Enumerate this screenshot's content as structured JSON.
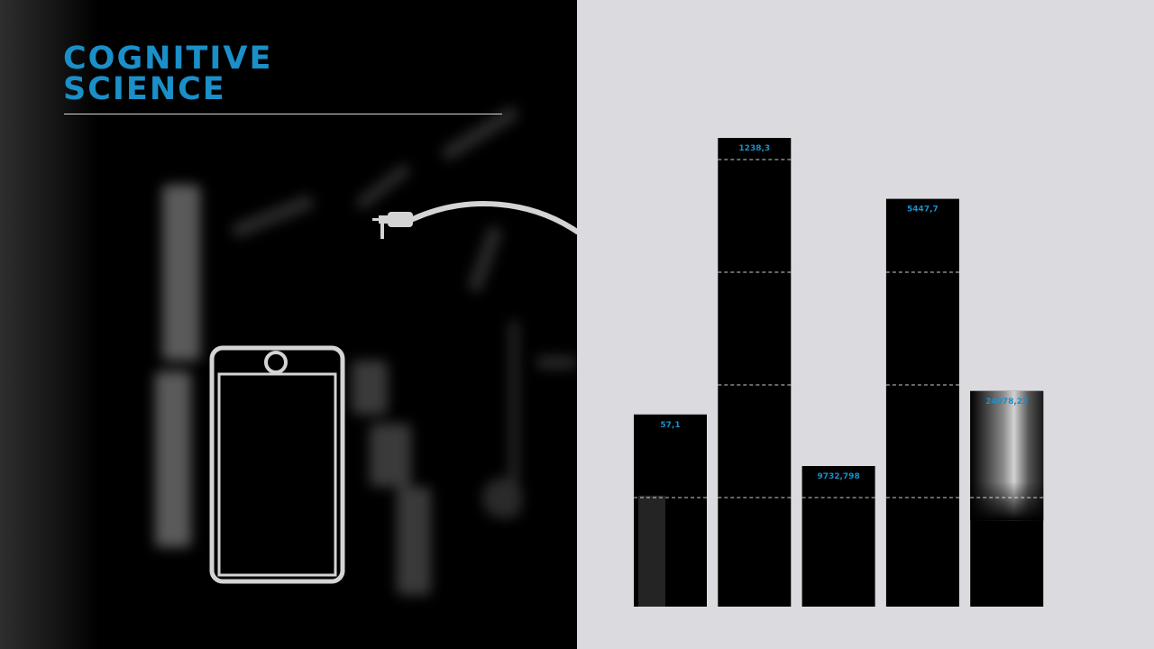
{
  "header": {
    "title_line1": "COGNITIVE",
    "title_line2": "SCIENCE"
  },
  "icons": {
    "phone": "smartphone-icon",
    "cable": "usb-cable-icon"
  },
  "colors": {
    "accent": "#1a8fc8",
    "left_background": "#000000",
    "right_background": "#dadadf",
    "bar_fill": "#000000",
    "gridline": "#ffffff"
  },
  "chart_data": {
    "type": "bar",
    "categories": [
      "",
      "",
      "",
      "",
      ""
    ],
    "labels": [
      "57,1",
      "1238,3",
      "9732,798",
      "5447,7",
      "24078,22"
    ],
    "heights": [
      0.41,
      1.0,
      0.3,
      0.87,
      0.46
    ],
    "height_note": "heights are relative bar heights shown visually; bar labels do not correspond to bar heights",
    "gridlines": 4,
    "grid": true,
    "axes_visible": false,
    "label_color": "#1a8fc8"
  }
}
